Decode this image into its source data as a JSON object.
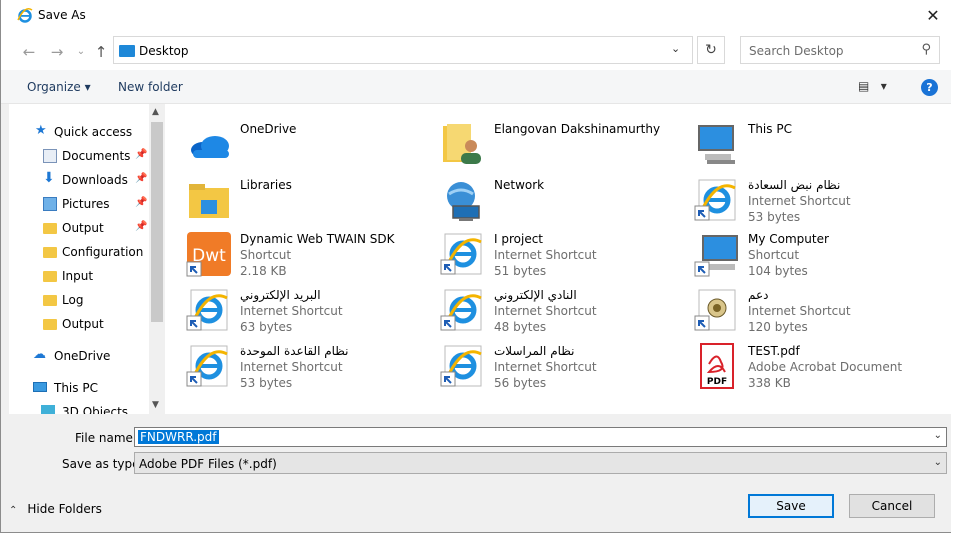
{
  "window": {
    "title": "Save As",
    "close_label": "✕"
  },
  "address": {
    "location": "Desktop",
    "search_placeholder": "Search Desktop"
  },
  "toolbar": {
    "organize_label": "Organize ▾",
    "new_folder_label": "New folder",
    "help_label": "?"
  },
  "nav": {
    "items": [
      {
        "label": "Quick access",
        "icon": "star-icon"
      },
      {
        "label": "Documents",
        "icon": "documents-icon",
        "pinned": true
      },
      {
        "label": "Downloads",
        "icon": "downloads-icon",
        "pinned": true
      },
      {
        "label": "Pictures",
        "icon": "pictures-icon",
        "pinned": true
      },
      {
        "label": "Output",
        "icon": "folder-icon",
        "pinned": true
      },
      {
        "label": "Configuration",
        "icon": "folder-icon"
      },
      {
        "label": "Input",
        "icon": "folder-icon"
      },
      {
        "label": "Log",
        "icon": "folder-icon"
      },
      {
        "label": "Output",
        "icon": "folder-icon"
      },
      {
        "label": "OneDrive",
        "icon": "cloud-icon"
      },
      {
        "label": "This PC",
        "icon": "computer-icon"
      },
      {
        "label": "3D Objects",
        "icon": "cube-icon"
      }
    ],
    "pin_glyph": "📌"
  },
  "files": [
    {
      "name": "OneDrive",
      "type": "",
      "size": "",
      "icon": "cloud-icon"
    },
    {
      "name": "Elangovan Dakshinamurthy",
      "type": "",
      "size": "",
      "icon": "user-folder-icon"
    },
    {
      "name": "This PC",
      "type": "",
      "size": "",
      "icon": "computer-icon"
    },
    {
      "name": "Libraries",
      "type": "",
      "size": "",
      "icon": "libraries-icon"
    },
    {
      "name": "Network",
      "type": "",
      "size": "",
      "icon": "network-icon"
    },
    {
      "name": "نظام نبض السعادة",
      "type": "Internet Shortcut",
      "size": "53 bytes",
      "icon": "ie-shortcut-icon"
    },
    {
      "name": "Dynamic Web TWAIN SDK",
      "type": "Shortcut",
      "size": "2.18 KB",
      "icon": "dwt-shortcut-icon"
    },
    {
      "name": "I project",
      "type": "Internet Shortcut",
      "size": "51 bytes",
      "icon": "ie-shortcut-icon"
    },
    {
      "name": "My Computer",
      "type": "Shortcut",
      "size": "104 bytes",
      "icon": "computer-shortcut-icon"
    },
    {
      "name": "البريد الإلكتروني",
      "type": "Internet Shortcut",
      "size": "63 bytes",
      "icon": "ie-shortcut-icon"
    },
    {
      "name": "النادي الإلكتروني",
      "type": "Internet Shortcut",
      "size": "48 bytes",
      "icon": "ie-shortcut-icon"
    },
    {
      "name": "دعم",
      "type": "Internet Shortcut",
      "size": "120 bytes",
      "icon": "emblem-shortcut-icon"
    },
    {
      "name": "نظام القاعدة الموحدة",
      "type": "Internet Shortcut",
      "size": "53 bytes",
      "icon": "ie-shortcut-icon"
    },
    {
      "name": "نظام المراسلات",
      "type": "Internet Shortcut",
      "size": "56 bytes",
      "icon": "ie-shortcut-icon"
    },
    {
      "name": "TEST.pdf",
      "type": "Adobe Acrobat Document",
      "size": "338 KB",
      "icon": "pdf-icon"
    }
  ],
  "form": {
    "file_name_label": "File name:",
    "file_name_value": "FNDWRR.pdf",
    "save_type_label": "Save as type:",
    "save_type_value": "Adobe PDF Files (*.pdf)",
    "hide_folders_label": "Hide Folders",
    "save_label": "Save",
    "cancel_label": "Cancel"
  },
  "icons": {
    "dwt_text": "Dwt",
    "pdf_text": "PDF"
  },
  "colors": {
    "accent": "#0078d7",
    "folder": "#f3c744",
    "pdf": "#d9222a",
    "dwt": "#f07b27"
  }
}
